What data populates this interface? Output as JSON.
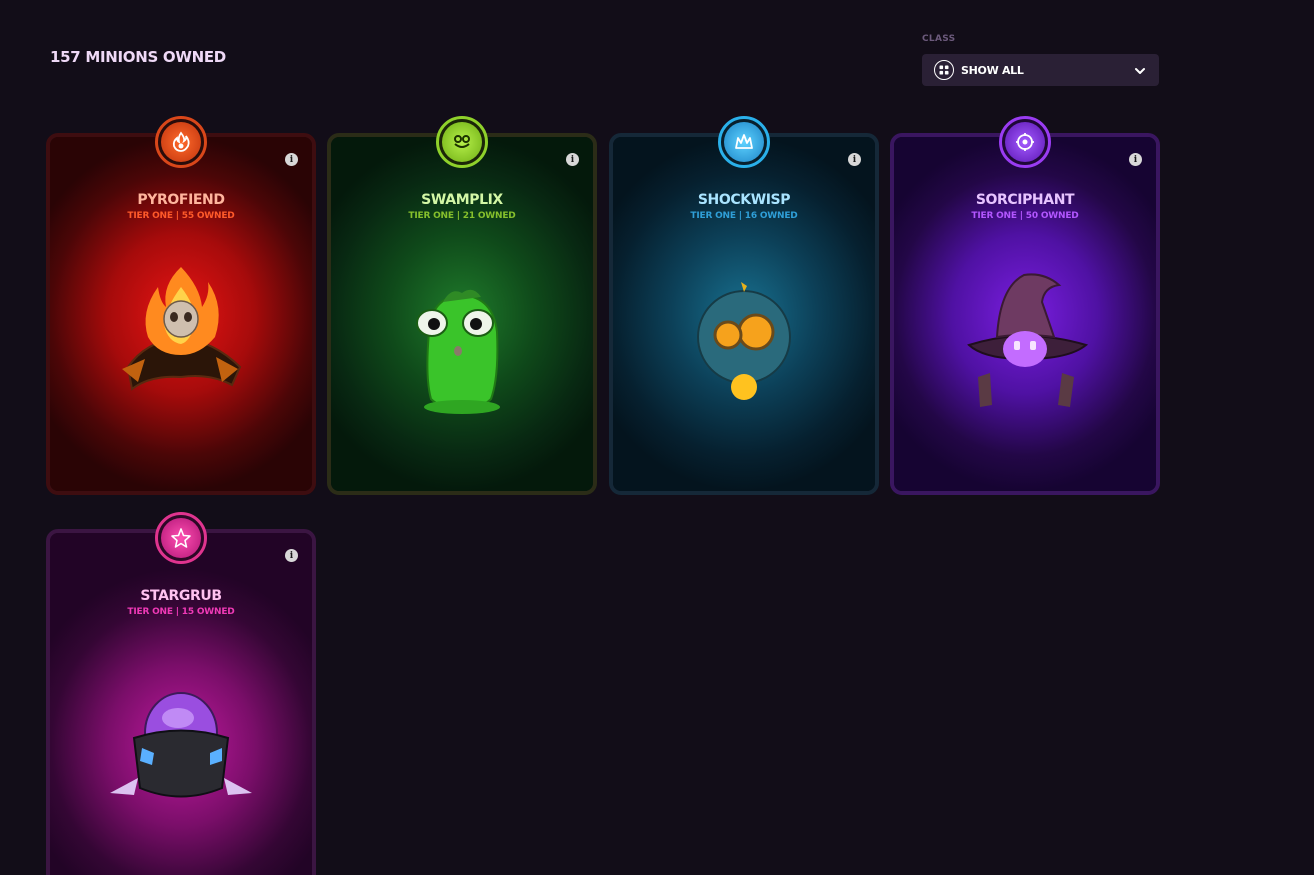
{
  "header": {
    "owned_title": "157 MINIONS OWNED"
  },
  "filter": {
    "label": "CLASS",
    "selected": "SHOW ALL"
  },
  "cards": [
    {
      "name": "PYROFIEND",
      "subtitle": "TIER ONE | 55 OWNED",
      "theme": "fire",
      "accent": "#e81414",
      "badge_icon": "fire-class-icon"
    },
    {
      "name": "SWAMPLIX",
      "subtitle": "TIER ONE | 21 OWNED",
      "theme": "swamp",
      "accent": "#1f7b2b",
      "badge_icon": "swamp-class-icon"
    },
    {
      "name": "SHOCKWISP",
      "subtitle": "TIER ONE | 16 OWNED",
      "theme": "shock",
      "accent": "#18708f",
      "badge_icon": "shock-class-icon"
    },
    {
      "name": "SORCIPHANT",
      "subtitle": "TIER ONE | 50 OWNED",
      "theme": "sorcery",
      "accent": "#7a1ee0",
      "badge_icon": "sorcery-class-icon"
    },
    {
      "name": "STARGRUB",
      "subtitle": "TIER ONE | 15 OWNED",
      "theme": "star",
      "accent": "#c0199f",
      "badge_icon": "star-class-icon"
    }
  ]
}
